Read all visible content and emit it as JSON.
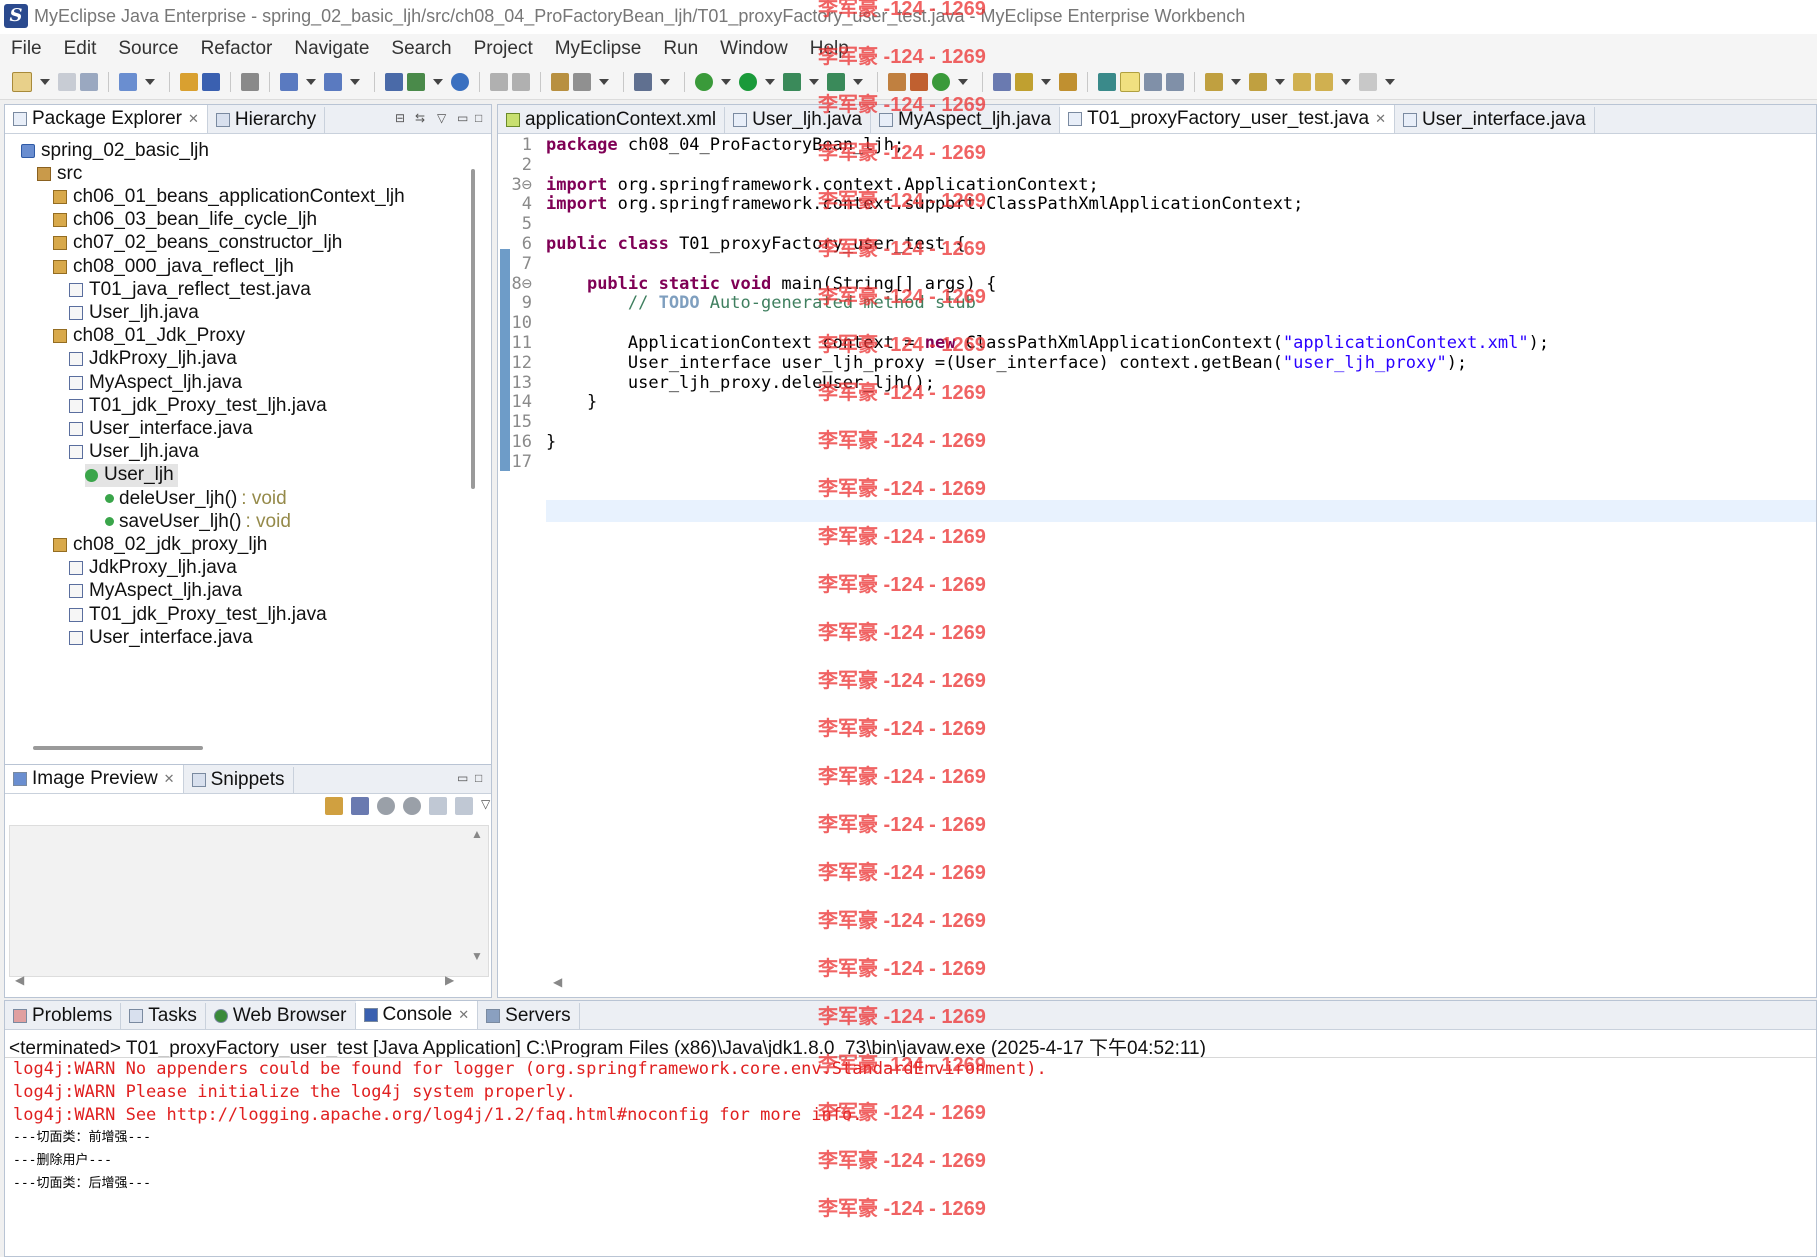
{
  "window": {
    "title": "MyEclipse Java Enterprise - spring_02_basic_ljh/src/ch08_04_ProFactoryBean_ljh/T01_proxyFactory_user_test.java - MyEclipse Enterprise Workbench"
  },
  "menu": [
    "File",
    "Edit",
    "Source",
    "Refactor",
    "Navigate",
    "Search",
    "Project",
    "MyEclipse",
    "Run",
    "Window",
    "Help"
  ],
  "explorer": {
    "tabs": [
      "Package Explorer",
      "Hierarchy"
    ],
    "tree": [
      {
        "label": "spring_02_basic_ljh",
        "icon": "project-icon"
      },
      {
        "label": "src",
        "icon": "source-folder-icon"
      },
      {
        "label": "ch06_01_beans_applicationContext_ljh",
        "icon": "package-icon"
      },
      {
        "label": "ch06_03_bean_life_cycle_ljh",
        "icon": "package-icon"
      },
      {
        "label": "ch07_02_beans_constructor_ljh",
        "icon": "package-icon"
      },
      {
        "label": "ch08_000_java_reflect_ljh",
        "icon": "package-icon"
      },
      {
        "label": "T01_java_reflect_test.java",
        "icon": "java-file-icon"
      },
      {
        "label": "User_ljh.java",
        "icon": "java-file-icon"
      },
      {
        "label": "ch08_01_Jdk_Proxy",
        "icon": "package-icon"
      },
      {
        "label": "JdkProxy_ljh.java",
        "icon": "java-file-icon"
      },
      {
        "label": "MyAspect_ljh.java",
        "icon": "java-file-icon"
      },
      {
        "label": "T01_jdk_Proxy_test_ljh.java",
        "icon": "java-file-icon"
      },
      {
        "label": "User_interface.java",
        "icon": "java-file-icon"
      },
      {
        "label": "User_ljh.java",
        "icon": "java-file-icon"
      },
      {
        "label": "User_ljh",
        "icon": "class-icon"
      },
      {
        "label": "deleUser_ljh()",
        "type": ": void",
        "icon": "method-icon"
      },
      {
        "label": "saveUser_ljh()",
        "type": ": void",
        "icon": "method-icon"
      },
      {
        "label": "ch08_02_jdk_proxy_ljh",
        "icon": "package-icon"
      },
      {
        "label": "JdkProxy_ljh.java",
        "icon": "java-file-icon"
      },
      {
        "label": "MyAspect_ljh.java",
        "icon": "java-file-icon"
      },
      {
        "label": "T01_jdk_Proxy_test_ljh.java",
        "icon": "java-file-icon"
      },
      {
        "label": "User_interface.java",
        "icon": "java-file-icon"
      }
    ]
  },
  "preview": {
    "tabs": [
      "Image Preview",
      "Snippets"
    ]
  },
  "editor": {
    "tabs": [
      "applicationContext.xml",
      "User_ljh.java",
      "MyAspect_ljh.java",
      "T01_proxyFactory_user_test.java",
      "User_interface.java"
    ],
    "active_tab": "T01_proxyFactory_user_test.java",
    "lines": [
      {
        "n": "1",
        "html": "<span class='kw'>package</span> ch08_04_ProFactoryBean_ljh;"
      },
      {
        "n": "2",
        "html": ""
      },
      {
        "n": "3⊖",
        "html": "<span class='kw'>import</span> org.springframework.context.ApplicationContext;"
      },
      {
        "n": "4",
        "html": "<span class='kw'>import</span> org.springframework.context.support.ClassPathXmlApplicationContext;"
      },
      {
        "n": "5",
        "html": ""
      },
      {
        "n": "6",
        "html": "<span class='kw'>public class</span> T01_proxyFactory_user_test {"
      },
      {
        "n": "7",
        "html": ""
      },
      {
        "n": "8⊖",
        "html": "    <span class='kw'>public static void</span> main(String[] args) {"
      },
      {
        "n": "9",
        "html": "        <span class='cmt'>// </span><span class='todo'>TODO</span><span class='cmt'> Auto-generated method stub</span>"
      },
      {
        "n": "10",
        "html": ""
      },
      {
        "n": "11",
        "html": "        ApplicationContext context = <span class='kw'>new</span> ClassPathXmlApplicationContext(<span class='str'>\"applicationContext.xml\"</span>);"
      },
      {
        "n": "12",
        "html": "        User_interface user_ljh_proxy =(User_interface) context.getBean(<span class='str'>\"user_ljh_proxy\"</span>);"
      },
      {
        "n": "13",
        "html": "        user_ljh_proxy.deleUser_ljh();"
      },
      {
        "n": "14",
        "html": "    }"
      },
      {
        "n": "15",
        "html": ""
      },
      {
        "n": "16",
        "html": "}"
      },
      {
        "n": "17",
        "html": ""
      }
    ]
  },
  "console": {
    "tabs": [
      "Problems",
      "Tasks",
      "Web Browser",
      "Console",
      "Servers"
    ],
    "header": "<terminated> T01_proxyFactory_user_test [Java Application] C:\\Program Files (x86)\\Java\\jdk1.8.0_73\\bin\\javaw.exe (2025-4-17 下午04:52:11)",
    "errors": [
      "log4j:WARN No appenders could be found for logger (org.springframework.core.env.StandardEnvironment).",
      "log4j:WARN Please initialize the log4j system properly.",
      "log4j:WARN See http://logging.apache.org/log4j/1.2/faq.html#noconfig for more info."
    ],
    "output": [
      "---切面类：前增强---",
      "---删除用户---",
      "---切面类：后增强---"
    ]
  },
  "watermark": "李军豪 -124 - 1269",
  "colors": {
    "keyword": "#7f0055",
    "string": "#2a00ff",
    "comment": "#3f7f5f",
    "error": "#e02020",
    "watermark": "#ec3030"
  }
}
